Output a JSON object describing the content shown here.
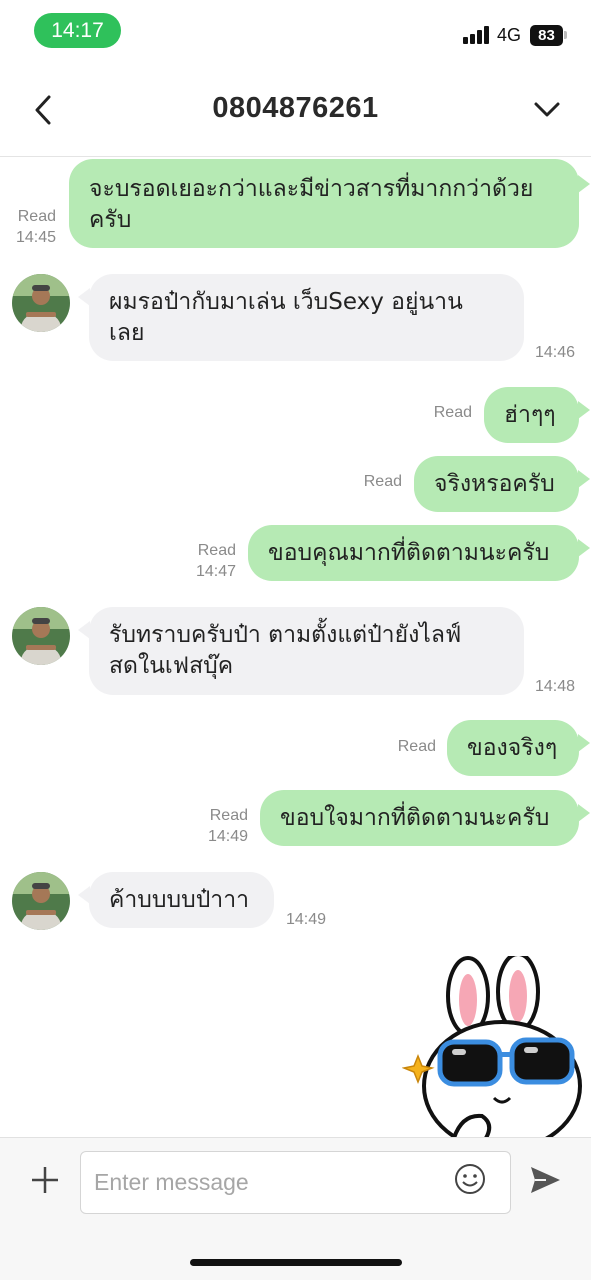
{
  "status_bar": {
    "time": "14:17",
    "network": "4G",
    "battery": "83"
  },
  "header": {
    "title": "0804876261"
  },
  "messages": [
    {
      "lines": [
        "จะบรอดเยอะกว่าและมีข่าวสารที่มากกว่าด้วย",
        "ครับ"
      ],
      "status": "Read",
      "time": "14:45"
    },
    {
      "lines": [
        "ผมรอป๋ากับมาเล่น เว็บSexy อยู่นาน",
        "เลย"
      ],
      "time": "14:46"
    },
    {
      "text": "ฮ่าๆๆ",
      "status": "Read"
    },
    {
      "text": "จริงหรอครับ",
      "status": "Read"
    },
    {
      "text": "ขอบคุณมากที่ติดตามนะครับ",
      "status": "Read",
      "time": "14:47"
    },
    {
      "lines": [
        "รับทราบครับป๋า  ตามตั้งแต่ป๋ายังไลฟ์",
        "สดในเฟสบุ๊ค"
      ],
      "time": "14:48"
    },
    {
      "text": "ของจริงๆ",
      "status": "Read"
    },
    {
      "text": "ขอบใจมากที่ติดตามนะครับ",
      "status": "Read",
      "time": "14:49"
    },
    {
      "text": "ค้าบบบบป๋าาา",
      "time": "14:49"
    }
  ],
  "input": {
    "placeholder": "Enter message"
  },
  "icons": [
    "back-icon",
    "chevron-down-icon",
    "plus-icon",
    "emoji-icon",
    "send-icon",
    "avatar",
    "sticker"
  ],
  "colors": {
    "outgoing_bubble": "#b6eab4",
    "incoming_bubble": "#f1f1f3",
    "status_pill": "#2fc15b"
  }
}
